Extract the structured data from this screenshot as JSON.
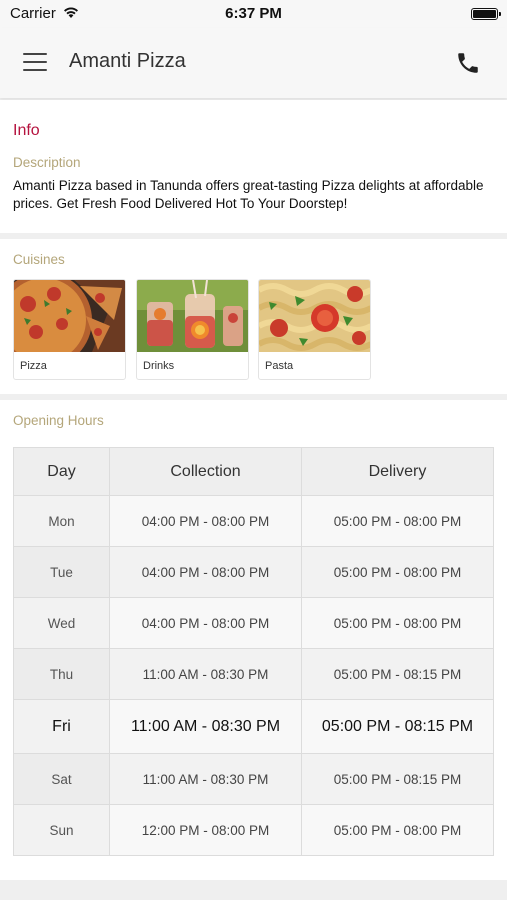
{
  "status_bar": {
    "carrier": "Carrier",
    "time": "6:37 PM"
  },
  "header": {
    "title": "Amanti Pizza",
    "menu_icon": "hamburger-menu-icon",
    "phone_icon": "phone-icon"
  },
  "info": {
    "title": "Info",
    "description_label": "Description",
    "description": "Amanti Pizza based in Tanunda offers great-tasting Pizza delights at affordable prices. Get Fresh Food Delivered Hot To Your Doorstep!"
  },
  "cuisines": {
    "label": "Cuisines",
    "items": [
      {
        "name": "Pizza"
      },
      {
        "name": "Drinks"
      },
      {
        "name": "Pasta"
      }
    ]
  },
  "hours": {
    "label": "Opening Hours",
    "headers": {
      "day": "Day",
      "collection": "Collection",
      "delivery": "Delivery"
    },
    "rows": [
      {
        "day": "Mon",
        "collection": "04:00 PM - 08:00 PM",
        "delivery": "05:00 PM - 08:00 PM"
      },
      {
        "day": "Tue",
        "collection": "04:00 PM - 08:00 PM",
        "delivery": "05:00 PM - 08:00 PM"
      },
      {
        "day": "Wed",
        "collection": "04:00 PM - 08:00 PM",
        "delivery": "05:00 PM - 08:00 PM"
      },
      {
        "day": "Thu",
        "collection": "11:00 AM - 08:30 PM",
        "delivery": "05:00 PM - 08:15 PM"
      },
      {
        "day": "Fri",
        "collection": "11:00 AM - 08:30 PM",
        "delivery": "05:00 PM - 08:15 PM"
      },
      {
        "day": "Sat",
        "collection": "11:00 AM - 08:30 PM",
        "delivery": "05:00 PM - 08:15 PM"
      },
      {
        "day": "Sun",
        "collection": "12:00 PM - 08:00 PM",
        "delivery": "05:00 PM - 08:00 PM"
      }
    ]
  },
  "colors": {
    "accent": "#b5123e",
    "label": "#b4a67a"
  }
}
